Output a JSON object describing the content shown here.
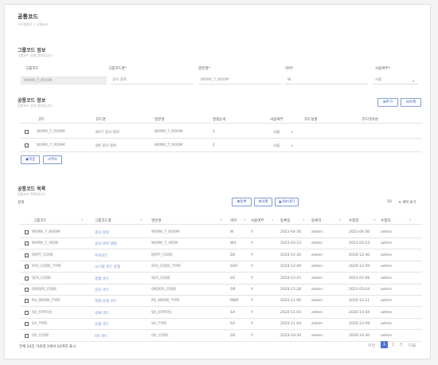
{
  "page": {
    "title": "공통코드",
    "breadcrumb": "시스템관리 > 공통코드"
  },
  "group_detail": {
    "title": "그룹코드 정보",
    "subtitle": "그룹코드 상세 정보입니다",
    "labels": [
      "그룹코드",
      "그룹코드명*",
      "영문명*",
      "약어*",
      "사용여부*"
    ],
    "values": [
      "WORK_T_ROOM",
      "검사 종류",
      "WORK_T_ROOM",
      "W",
      "사용"
    ]
  },
  "code_detail": {
    "title": "공통코드 정보",
    "subtitle": "공통코드 상세 정보입니다",
    "add_label": "추가",
    "delete_label": "삭제",
    "headers": [
      "코드",
      "코드명",
      "영문명",
      "정렬순서",
      "사용여부",
      "코드설명",
      "코드라이센"
    ],
    "rows": [
      {
        "code": "WORK_T_ROOM",
        "name": "WCT 검사 장비",
        "eng": "WORK_T_ROOM",
        "order": "1",
        "use": "사용"
      },
      {
        "code": "WORK_T_ROOM",
        "name": "DR 검사 장비",
        "eng": "WORK_T_ROOM",
        "order": "2",
        "use": "사용"
      }
    ],
    "save_label": "저장",
    "cancel_label": "취소"
  },
  "code_list": {
    "title": "공통코드 목록",
    "subtitle": "공통코드 목록입니다",
    "search_label": "검색",
    "register_label": "등록",
    "delete_label": "삭제",
    "excel_label": "내보내기",
    "page_size": "10",
    "page_size_suffix": "개씩 보기",
    "headers": [
      "그룹코드",
      "그룹코드명",
      "영문명",
      "약어",
      "사용여부",
      "등록일",
      "등록자",
      "수정일",
      "수정자"
    ],
    "rows": [
      {
        "group": "WORK_T_ROOM",
        "name": "검사 장비",
        "eng": "WORK_T_ROOM",
        "abbr": "W",
        "use": "Y",
        "reg_date": "2021-04-30",
        "reg_user": "admin",
        "mod_date": "2021-04-30",
        "mod_user": "admin"
      },
      {
        "group": "WORK_T_VIEW",
        "name": "검사 위치 명칭",
        "eng": "WORK_T_VIEW",
        "abbr": "WV",
        "use": "Y",
        "reg_date": "2021-03-23",
        "reg_user": "admin",
        "mod_date": "2021-03-23",
        "mod_user": "admin"
      },
      {
        "group": "DEPT_CODE",
        "name": "부서코드",
        "eng": "DEPT_CODE",
        "abbr": "DE",
        "use": "Y",
        "reg_date": "2020-12-30",
        "reg_user": "admin",
        "mod_date": "2020-12-30",
        "mod_user": "admin"
      },
      {
        "group": "SYS_CODE_TYPE",
        "name": "시스템 코드 유형",
        "eng": "SYS_CODE_TYPE",
        "abbr": "SXR",
        "use": "Y",
        "reg_date": "2020-12-09",
        "reg_user": "admin",
        "mod_date": "2020-12-09",
        "mod_user": "admin"
      },
      {
        "group": "SEX_CODE",
        "name": "성별 코드",
        "eng": "SEX_CODE",
        "abbr": "SX",
        "use": "Y",
        "reg_date": "2020-12-25",
        "reg_user": "admin",
        "mod_date": "2021-01-08",
        "mod_user": "admin"
      },
      {
        "group": "ORDER_CODE",
        "name": "오더 코드",
        "eng": "ORDER_CODE",
        "abbr": "OR",
        "use": "Y",
        "reg_date": "2020-11-28",
        "reg_user": "admin",
        "mod_date": "2021-03-04",
        "mod_user": "admin"
      },
      {
        "group": "RS_WORK_TYPE",
        "name": "작업 유형 코드",
        "eng": "RS_WORK_TYPE",
        "abbr": "RWR",
        "use": "Y",
        "reg_date": "2020-11-06",
        "reg_user": "admin",
        "mod_date": "2020-12-11",
        "mod_user": "admin"
      },
      {
        "group": "SA_STATUS",
        "name": "상태 코드",
        "eng": "SA_STATUS",
        "abbr": "SA",
        "use": "Y",
        "reg_date": "2020-11-04",
        "reg_user": "admin",
        "mod_date": "2020-11-04",
        "mod_user": "admin"
      },
      {
        "group": "SA_TYPE",
        "name": "유형 코드",
        "eng": "SA_TYPE",
        "abbr": "SA",
        "use": "Y",
        "reg_date": "2020-11-04",
        "reg_user": "admin",
        "mod_date": "2020-12-09",
        "mod_user": "admin"
      },
      {
        "group": "OS_CODE",
        "name": "OS 코드",
        "eng": "OS_CODE",
        "abbr": "OS",
        "use": "Y",
        "reg_date": "2020-10-30",
        "reg_user": "admin",
        "mod_date": "2020-10-30",
        "mod_user": "admin"
      }
    ],
    "summary": "전체 24건 가운데 1에서 10까지 표시",
    "pager": {
      "prev": "이전",
      "pages": [
        "1",
        "2",
        "3"
      ],
      "next": "다음"
    }
  },
  "colors": {
    "accent": "#4a74d6",
    "link": "#6a85c9"
  }
}
